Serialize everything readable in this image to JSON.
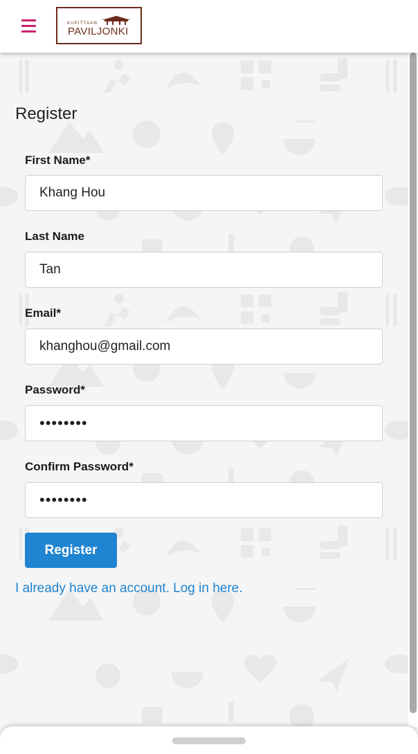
{
  "header": {
    "logo_small": "KUPITTAAN",
    "logo_big": "PAVILJONKI"
  },
  "colors": {
    "accent": "#c81e6c",
    "primary": "#1f84d1",
    "brand": "#6b2b1c"
  },
  "icons": {
    "menu": "hamburger-icon"
  },
  "form": {
    "title": "Register",
    "fields": [
      {
        "label": "First Name*",
        "value": "Khang Hou"
      },
      {
        "label": "Last Name",
        "value": "Tan"
      },
      {
        "label": "Email*",
        "value": "khanghou@gmail.com"
      },
      {
        "label": "Password*",
        "value": "••••••••"
      },
      {
        "label": "Confirm Password*",
        "value": "••••••••"
      }
    ],
    "submit_label": "Register",
    "login_link": "I already have an account. Log in here."
  }
}
